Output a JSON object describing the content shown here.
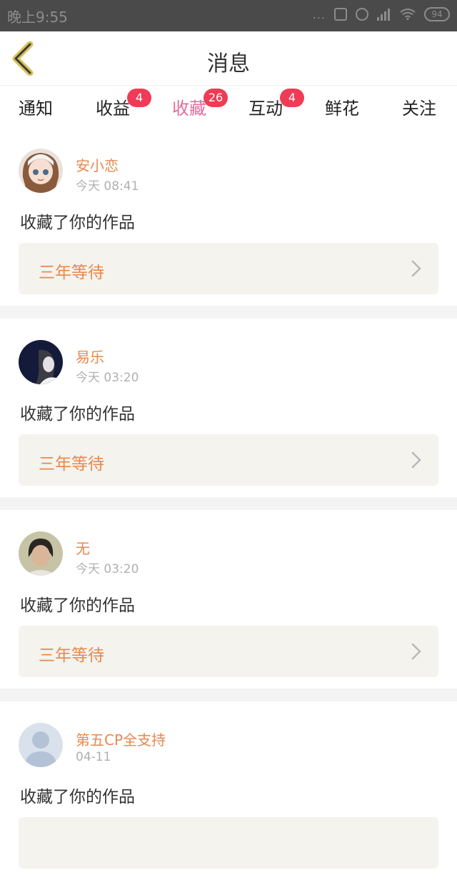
{
  "status_bar": {
    "time": "晚上9:55",
    "dots": "...",
    "battery": "94"
  },
  "header": {
    "title": "消息"
  },
  "tabs": [
    {
      "label": "通知",
      "badge": null,
      "active": false
    },
    {
      "label": "收益",
      "badge": "4",
      "active": false
    },
    {
      "label": "收藏",
      "badge": "26",
      "active": true
    },
    {
      "label": "互动",
      "badge": "4",
      "active": false
    },
    {
      "label": "鲜花",
      "badge": null,
      "active": false
    },
    {
      "label": "关注",
      "badge": null,
      "active": false
    }
  ],
  "colors": {
    "accent_pink": "#e86a9a",
    "badge_red": "#ef3b55",
    "name_orange": "#e8884e"
  },
  "messages": [
    {
      "user": "安小恋",
      "time": "今天 08:41",
      "action": "收藏了你的作品",
      "work_title": "三年等待"
    },
    {
      "user": "易乐",
      "time": "今天 03:20",
      "action": "收藏了你的作品",
      "work_title": "三年等待"
    },
    {
      "user": "无",
      "time": "今天 03:20",
      "action": "收藏了你的作品",
      "work_title": "三年等待"
    },
    {
      "user": "第五CP全支持",
      "time": "04-11",
      "action": "收藏了你的作品",
      "work_title": ""
    }
  ]
}
